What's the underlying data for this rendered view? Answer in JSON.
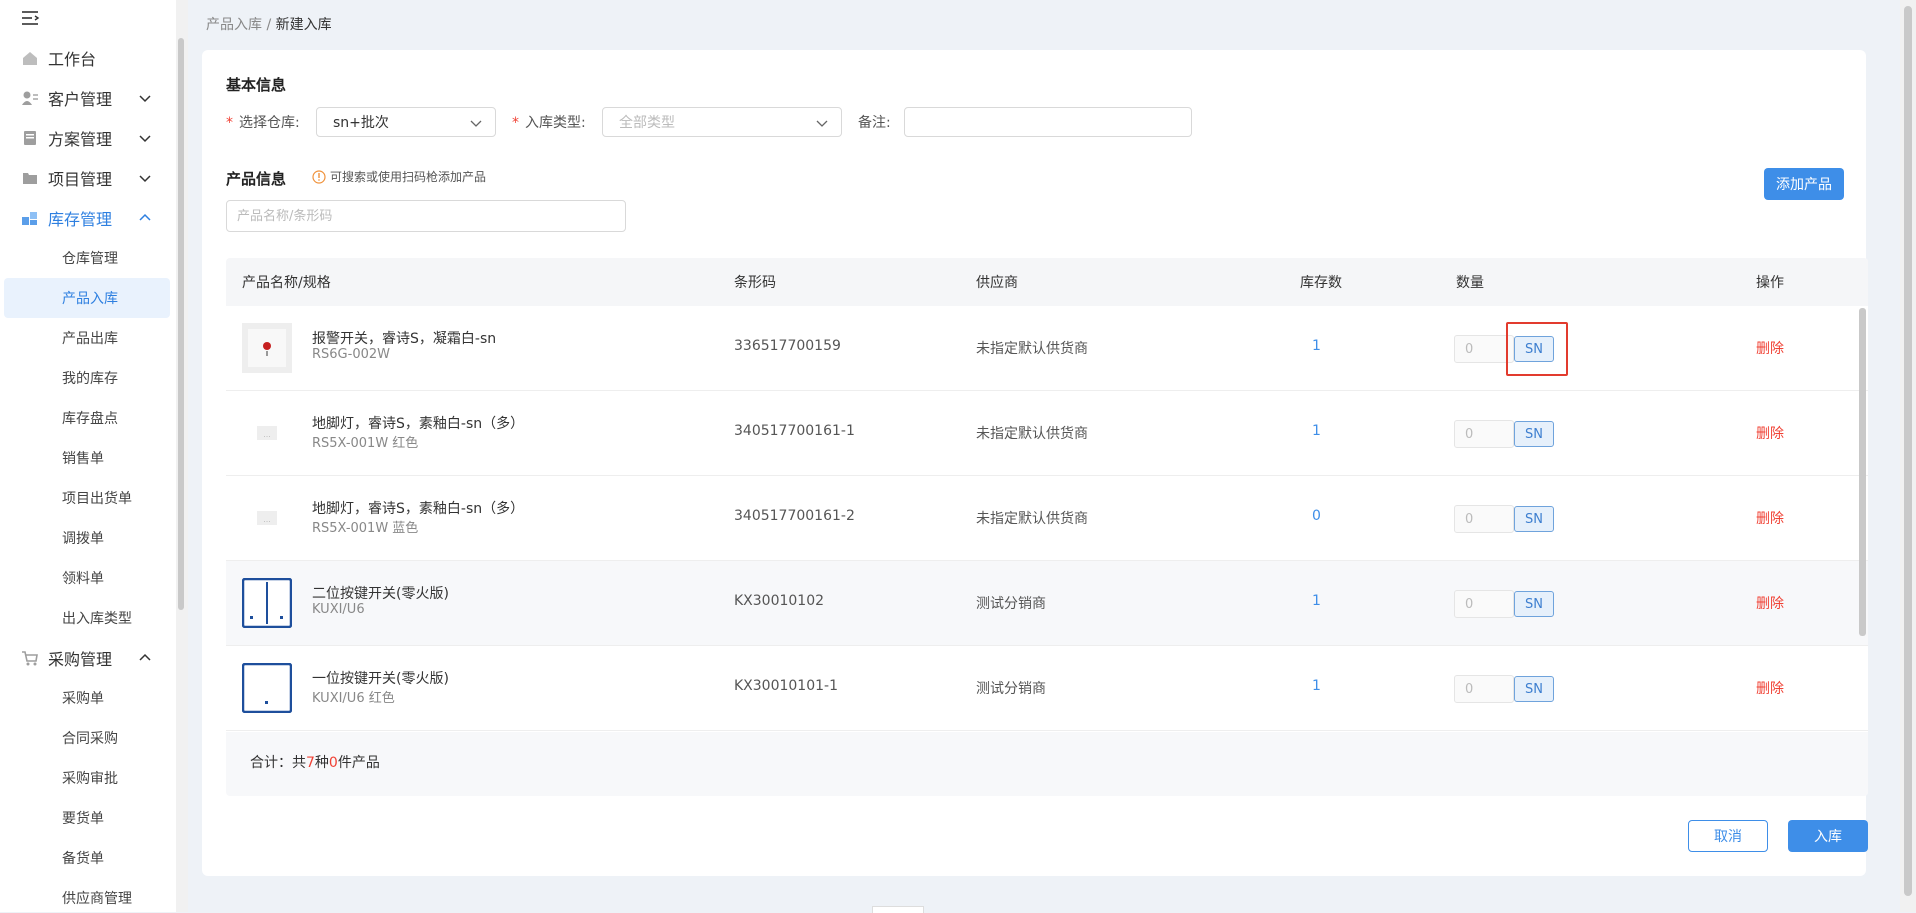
{
  "sidebar": {
    "toggle_icon": "menu-collapse-icon",
    "items": [
      {
        "label": "工作台",
        "icon": "home-icon"
      },
      {
        "label": "客户管理",
        "icon": "customer-icon"
      },
      {
        "label": "方案管理",
        "icon": "plan-icon"
      },
      {
        "label": "项目管理",
        "icon": "folder-icon"
      },
      {
        "label": "库存管理",
        "icon": "inventory-icon"
      },
      {
        "label": "采购管理",
        "icon": "cart-icon"
      }
    ],
    "inventory_sub": [
      "仓库管理",
      "产品入库",
      "产品出库",
      "我的库存",
      "库存盘点",
      "销售单",
      "项目出货单",
      "调拨单",
      "领料单",
      "出入库类型"
    ],
    "purchase_sub": [
      "采购单",
      "合同采购",
      "采购审批",
      "要货单",
      "备货单",
      "供应商管理"
    ]
  },
  "breadcrumb": {
    "parent": "产品入库",
    "sep": " / ",
    "current": "新建入库"
  },
  "basic": {
    "title": "基本信息",
    "warehouse_label": "选择仓库:",
    "warehouse_value": "sn+批次",
    "type_label": "入库类型:",
    "type_placeholder": "全部类型",
    "remark_label": "备注:",
    "remark_value": ""
  },
  "product": {
    "title": "产品信息",
    "hint": "可搜索或使用扫码枪添加产品",
    "search_placeholder": "产品名称/条形码",
    "add_button": "添加产品"
  },
  "table": {
    "headers": [
      "产品名称/规格",
      "条形码",
      "供应商",
      "库存数",
      "数量",
      "操作"
    ],
    "rows": [
      {
        "name": "报警开关，睿诗S，凝霜白-sn",
        "spec": "RS6G-002W",
        "barcode": "336517700159",
        "supplier": "未指定默认供货商",
        "stock": "1",
        "qty": "0",
        "sn": "SN",
        "action": "删除",
        "thumb": "alarm-switch"
      },
      {
        "name": "地脚灯，睿诗S，素釉白-sn（多）",
        "spec": "RS5X-001W 红色",
        "barcode": "340517700161-1",
        "supplier": "未指定默认供货商",
        "stock": "1",
        "qty": "0",
        "sn": "SN",
        "action": "删除",
        "thumb": "placeholder"
      },
      {
        "name": "地脚灯，睿诗S，素釉白-sn（多）",
        "spec": "RS5X-001W 蓝色",
        "barcode": "340517700161-2",
        "supplier": "未指定默认供货商",
        "stock": "0",
        "qty": "0",
        "sn": "SN",
        "action": "删除",
        "thumb": "placeholder"
      },
      {
        "name": "二位按键开关(零火版)",
        "spec": "KUXI/U6",
        "barcode": "KX30010102",
        "supplier": "测试分销商",
        "stock": "1",
        "qty": "0",
        "sn": "SN",
        "action": "删除",
        "thumb": "switch-two"
      },
      {
        "name": "一位按键开关(零火版)",
        "spec": "KUXI/U6 红色",
        "barcode": "KX30010101-1",
        "supplier": "测试分销商",
        "stock": "1",
        "qty": "0",
        "sn": "SN",
        "action": "删除",
        "thumb": "switch-one"
      }
    ],
    "footer": {
      "prefix": "合计：共",
      "kinds": "7",
      "mid": "种",
      "count": "0",
      "suffix": "件产品"
    }
  },
  "actions": {
    "cancel": "取消",
    "submit": "入库"
  },
  "colors": {
    "primary": "#3e8ee8",
    "danger": "#f04134",
    "highlight": "#e23b2e"
  }
}
